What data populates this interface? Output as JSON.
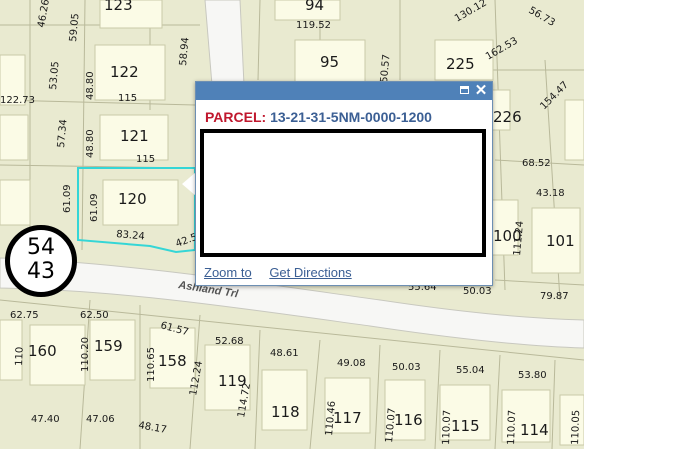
{
  "map": {
    "lot_numbers": [
      "123",
      "94",
      "122",
      "95",
      "225",
      "121",
      "226",
      "120",
      "100",
      "101",
      "160",
      "159",
      "158",
      "119",
      "118",
      "117",
      "116",
      "115",
      "114"
    ],
    "dimension_labels": [
      "46.26",
      "59.05",
      "58.94",
      "119.52",
      "130.12",
      "56.73",
      "53.05",
      "48.80",
      "115",
      "122.73",
      "50.57",
      "162.53",
      "154.47",
      "57.34",
      "48.80",
      "115",
      "68.52",
      "61.09",
      "61.09",
      "83.24",
      "42.5",
      "43.18",
      "111.24",
      "55.64",
      "50.03",
      "79.87",
      "62.75",
      "62.50",
      "61.57",
      "52.68",
      "48.61",
      "49.08",
      "50.03",
      "55.04",
      "53.80",
      "110.20",
      "110.65",
      "112.24",
      "114.72",
      "110.46",
      "110.07",
      "110.07",
      "110.07",
      "110.05",
      "47.40",
      "47.06",
      "48.17",
      "110"
    ],
    "street_name": "Ashland Trl",
    "selection_color": "#35d6d6"
  },
  "badge": {
    "line1": "54",
    "line2": "43"
  },
  "popup": {
    "parcel_label": "PARCEL:",
    "parcel_id": "13-21-31-5NM-0000-1200",
    "maximize_icon": "maximize-icon",
    "close_icon": "close-icon",
    "close_glyph": "✕",
    "zoom_link": "Zoom to",
    "directions_link": "Get Directions"
  }
}
